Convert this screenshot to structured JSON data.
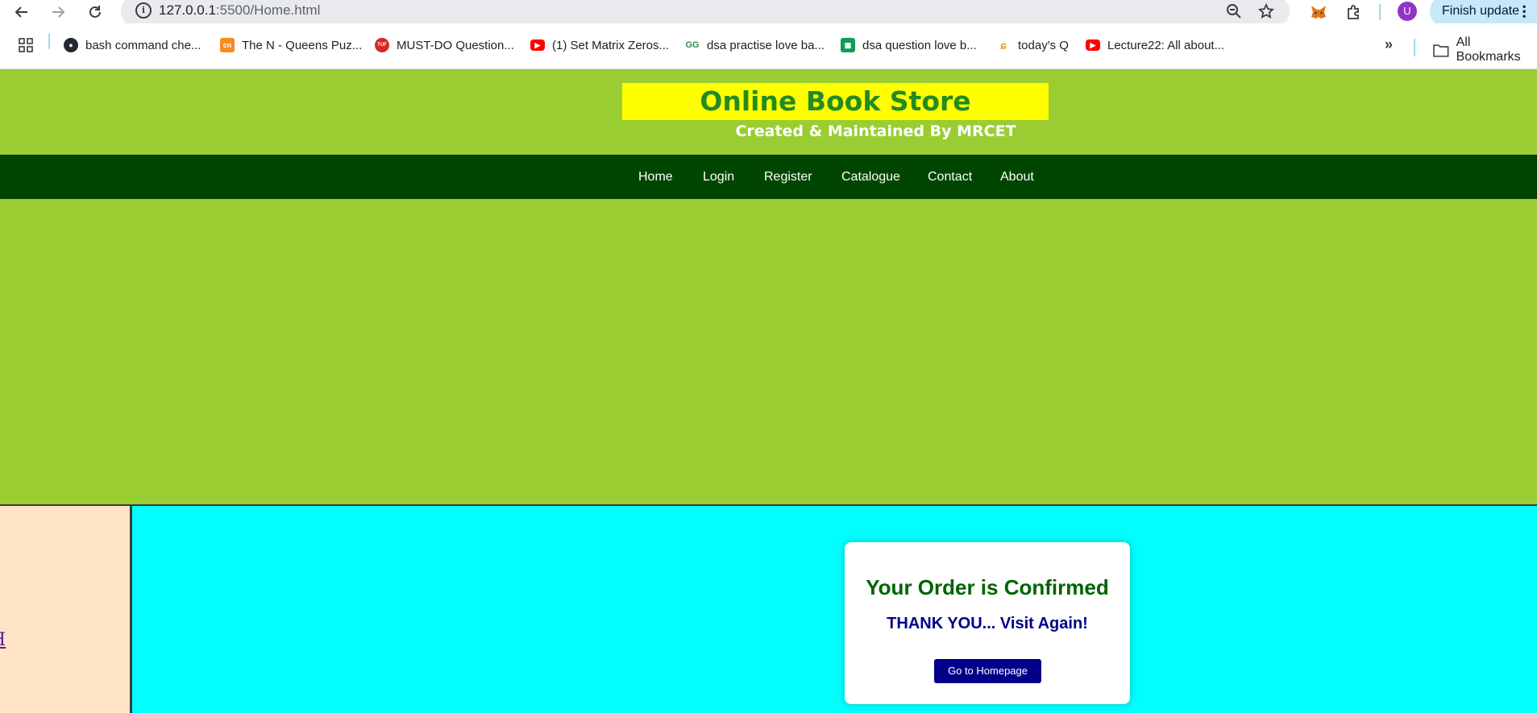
{
  "browser": {
    "url_host": "127.0.0.1",
    "url_rest": ":5500/Home.html",
    "avatar_letter": "U",
    "finish_update_label": "Finish update",
    "bookmarks": [
      {
        "label": "bash command che...",
        "icon": "github-icon"
      },
      {
        "label": "The N - Queens Puz...",
        "icon": "codingninjas-icon"
      },
      {
        "label": "MUST-DO Question...",
        "icon": "tuf-icon"
      },
      {
        "label": "(1) Set Matrix Zeros...",
        "icon": "youtube-icon"
      },
      {
        "label": "dsa practise love ba...",
        "icon": "geeksforgeeks-icon"
      },
      {
        "label": "dsa question love b...",
        "icon": "google-sheets-icon"
      },
      {
        "label": "today's Q",
        "icon": "leetcode-icon"
      },
      {
        "label": "Lecture22: All about...",
        "icon": "youtube-icon"
      }
    ],
    "all_bookmarks_label": "All Bookmarks"
  },
  "site": {
    "title": "Online Book Store",
    "subtitle": "Created & Maintained By MRCET",
    "nav": [
      "Home",
      "Login",
      "Register",
      "Catalogue",
      "Contact",
      "About"
    ],
    "left_link_text": "H"
  },
  "confirmation": {
    "title": "Your Order is Confirmed",
    "message": "THANK YOU... Visit Again!",
    "button_label": "Go to Homepage"
  },
  "colors": {
    "header_bg": "#9acd32",
    "title_bg": "#ffff00",
    "title_text": "#228b22",
    "nav_bg": "#004600",
    "main_frame_bg": "#00ffff",
    "left_frame_bg": "#ffe4c7",
    "button_bg": "#00008b"
  }
}
